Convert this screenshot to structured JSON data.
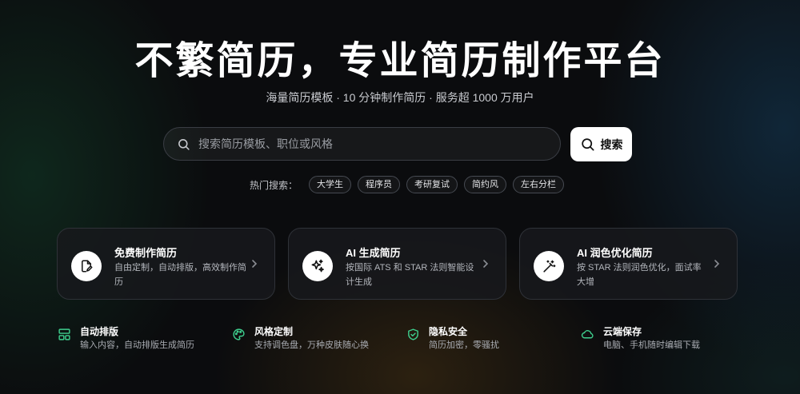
{
  "hero": {
    "title": "不繁简历，专业简历制作平台",
    "subtitle": "海量简历模板 · 10 分钟制作简历 · 服务超 1000 万用户"
  },
  "search": {
    "placeholder": "搜索简历模板、职位或风格",
    "value": "",
    "button_label": "搜索"
  },
  "hot_search": {
    "label": "热门搜索：",
    "tags": [
      "大学生",
      "程序员",
      "考研复试",
      "简约风",
      "左右分栏"
    ]
  },
  "cards": [
    {
      "title": "免费制作简历",
      "desc": "自由定制，自动排版，高效制作简历",
      "icon": "document-edit-icon"
    },
    {
      "title": "AI 生成简历",
      "desc": "按国际 ATS 和 STAR 法则智能设计生成",
      "icon": "sparkle-icon"
    },
    {
      "title": "AI 润色优化简历",
      "desc": "按 STAR 法则润色优化，面试率大增",
      "icon": "magic-wand-icon"
    }
  ],
  "features": [
    {
      "title": "自动排版",
      "desc": "输入内容，自动排版生成简历",
      "icon": "layout-icon"
    },
    {
      "title": "风格定制",
      "desc": "支持调色盘，万种皮肤随心换",
      "icon": "palette-icon"
    },
    {
      "title": "隐私安全",
      "desc": "简历加密，零骚扰",
      "icon": "shield-check-icon"
    },
    {
      "title": "云端保存",
      "desc": "电脑、手机随时编辑下载",
      "icon": "cloud-icon"
    }
  ],
  "colors": {
    "accent_green": "#3ecf8e",
    "background": "#0b0c0e",
    "button_bg": "#ffffff"
  }
}
